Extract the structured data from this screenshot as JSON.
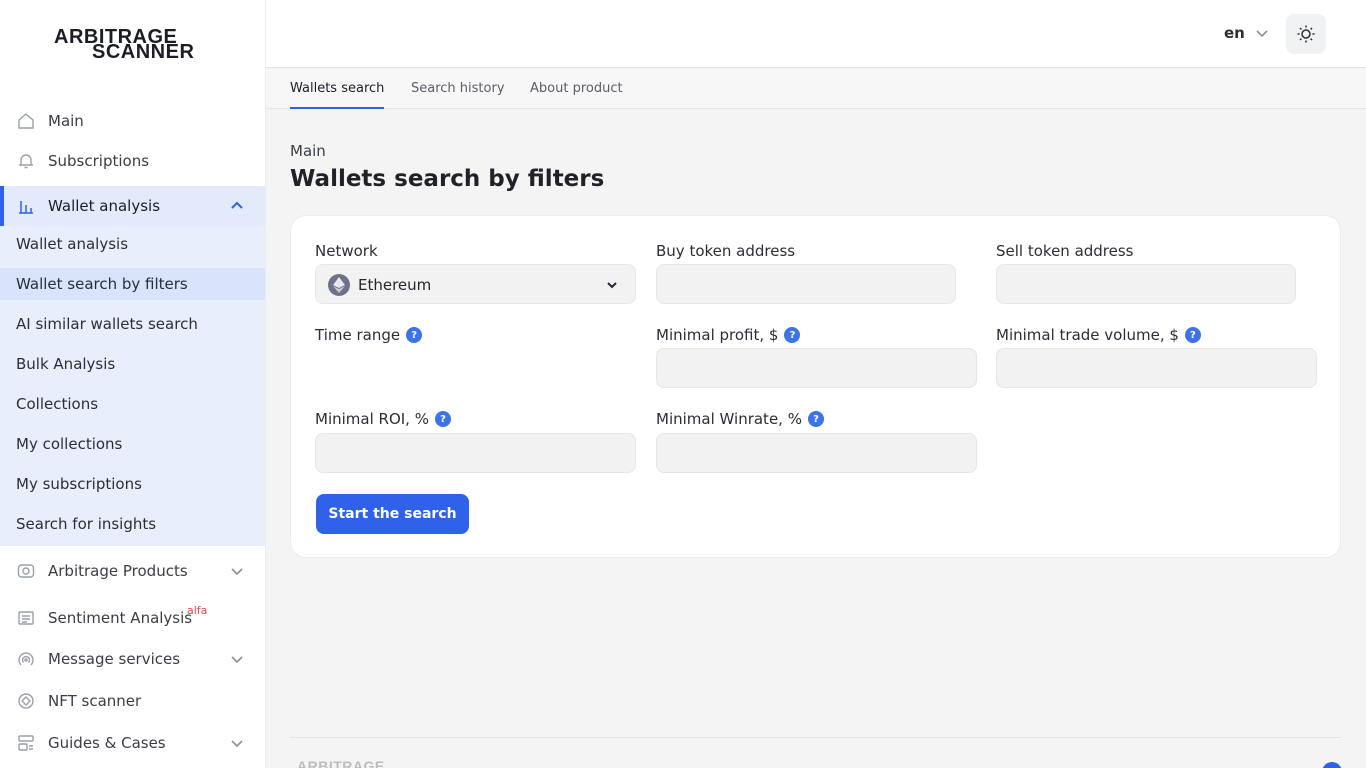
{
  "brand": {
    "line1": "ARBITRAGE",
    "line2": "SCANNER"
  },
  "header": {
    "language": "en"
  },
  "tabs": [
    {
      "label": "Wallets search",
      "active": true
    },
    {
      "label": "Search history",
      "active": false
    },
    {
      "label": "About product",
      "active": false
    }
  ],
  "sidebar": {
    "items": [
      {
        "label": "Main",
        "icon": "home-icon"
      },
      {
        "label": "Subscriptions",
        "icon": "bell-icon"
      },
      {
        "label": "Wallet analysis",
        "icon": "chart-bar-icon",
        "expanded": true
      },
      {
        "label": "Arbitrage Products",
        "icon": "eye-icon"
      },
      {
        "label": "Sentiment Analysis",
        "badge": "alfa",
        "icon": "newspaper-icon"
      },
      {
        "label": "Message services",
        "icon": "broadcast-icon"
      },
      {
        "label": "NFT scanner",
        "icon": "nft-icon"
      },
      {
        "label": "Guides & Cases",
        "icon": "guide-icon"
      }
    ],
    "submenu": [
      "Wallet analysis",
      "Wallet search by filters",
      "AI similar wallets search",
      "Bulk Analysis",
      "Collections",
      "My collections",
      "My subscriptions",
      "Search for insights"
    ],
    "selected_submenu": "Wallet search by filters"
  },
  "page": {
    "breadcrumb": "Main",
    "title": "Wallets search by filters"
  },
  "form": {
    "network_label": "Network",
    "network_value": "Ethereum",
    "buy_label": "Buy token address",
    "sell_label": "Sell token address",
    "time_range_label": "Time range",
    "min_profit_label": "Minimal profit, $",
    "min_volume_label": "Minimal trade volume, $",
    "min_roi_label": "Minimal ROI, %",
    "min_winrate_label": "Minimal Winrate, %",
    "help_glyph": "?",
    "submit_label": "Start the search"
  },
  "footer": {
    "logo_text": "ARBITRAGE"
  },
  "colors": {
    "accent": "#2f62e8",
    "submenu_bg": "#e8eefc",
    "help": "#3c73e6",
    "alfa": "#e24a4a"
  }
}
